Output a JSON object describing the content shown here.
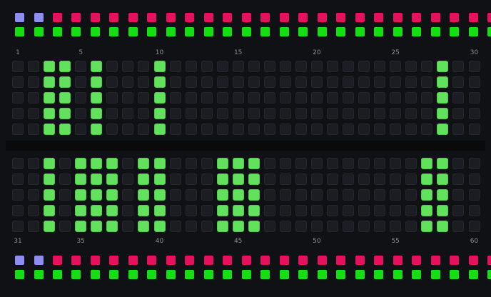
{
  "rail_colors": {
    "blue": "#8f8cf2",
    "pink": "#e5115f",
    "green": "#13df13"
  },
  "top_rail": {
    "row1": [
      "blue",
      "blue",
      "pink",
      "pink",
      "pink",
      "pink",
      "pink",
      "pink",
      "pink",
      "pink",
      "pink",
      "pink",
      "pink",
      "pink",
      "pink",
      "pink",
      "pink",
      "pink",
      "pink",
      "pink",
      "pink",
      "pink",
      "pink",
      "pink",
      "pink",
      "pink"
    ],
    "row2": [
      "green",
      "green",
      "green",
      "green",
      "green",
      "green",
      "green",
      "green",
      "green",
      "green",
      "green",
      "green",
      "green",
      "green",
      "green",
      "green",
      "green",
      "green",
      "green",
      "green",
      "green",
      "green",
      "green",
      "green",
      "green",
      "green"
    ]
  },
  "bottom_rail": {
    "row1": [
      "blue",
      "blue",
      "pink",
      "pink",
      "pink",
      "pink",
      "pink",
      "pink",
      "pink",
      "pink",
      "pink",
      "pink",
      "pink",
      "pink",
      "pink",
      "pink",
      "pink",
      "pink",
      "pink",
      "pink",
      "pink",
      "pink",
      "pink",
      "pink",
      "pink",
      "pink"
    ],
    "row2": [
      "green",
      "green",
      "green",
      "green",
      "green",
      "green",
      "green",
      "green",
      "green",
      "green",
      "green",
      "green",
      "green",
      "green",
      "green",
      "green",
      "green",
      "green",
      "green",
      "green",
      "green",
      "green",
      "green",
      "green",
      "green",
      "green"
    ]
  },
  "top_numbers": [
    "1",
    "5",
    "10",
    "15",
    "20",
    "25",
    "30"
  ],
  "bottom_numbers": [
    "31",
    "35",
    "40",
    "45",
    "50",
    "55",
    "60"
  ],
  "top_lit_columns": [
    3,
    4,
    6,
    10,
    28
  ],
  "bottom_lit_columns": [
    3,
    5,
    6,
    7,
    9,
    10,
    14,
    15,
    16,
    27,
    28
  ],
  "rows_per_bank": 5,
  "columns": 30
}
